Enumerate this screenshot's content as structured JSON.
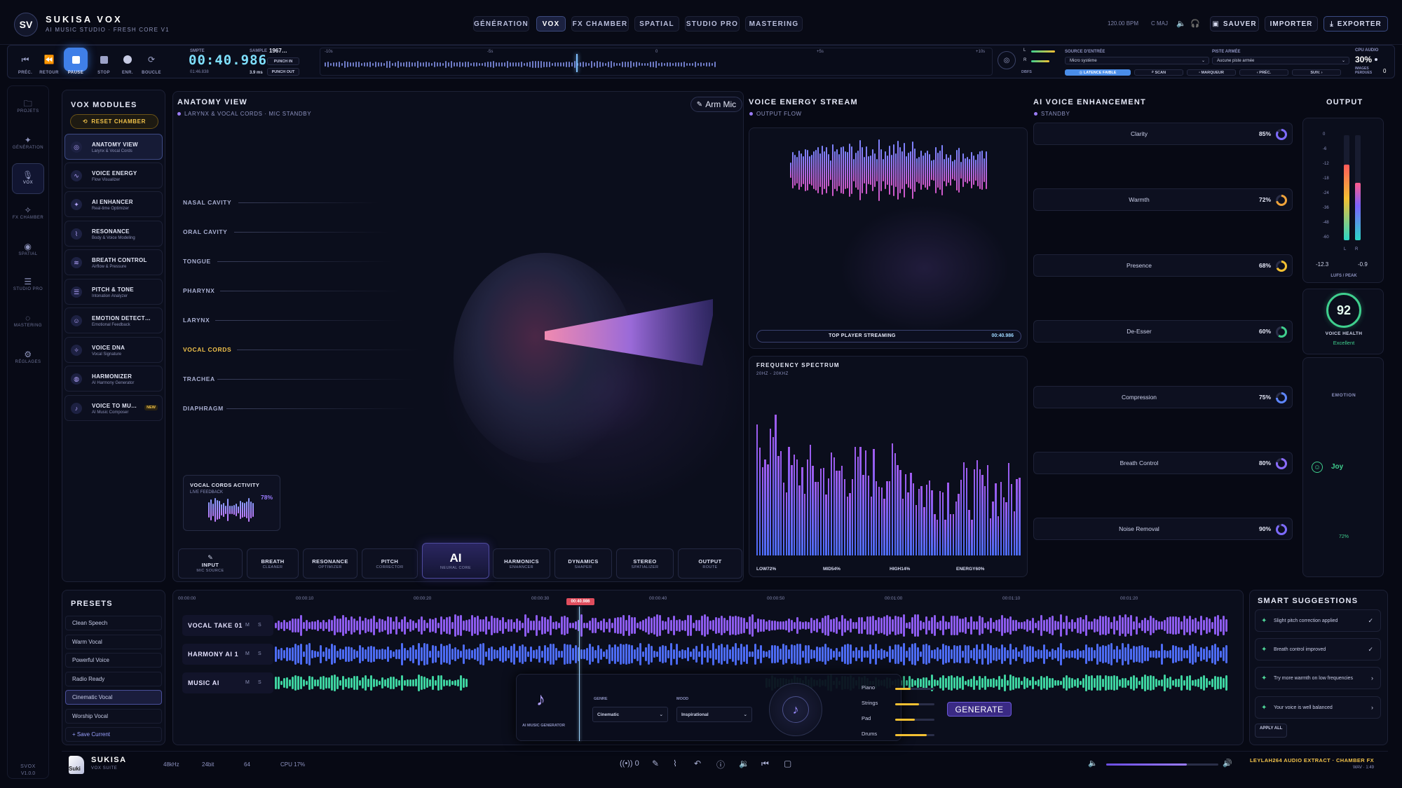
{
  "app": {
    "badge": "SV",
    "name": "SUKISA VOX",
    "tagline": "AI MUSIC STUDIO · FRESH CORE V1"
  },
  "nav_tabs": [
    "GÉNÉRATION",
    "VOX",
    "FX CHAMBER",
    "SPATIAL",
    "STUDIO PRO",
    "MASTERING"
  ],
  "header_right": {
    "bpm": "120.00 BPM",
    "key": "C MAJ",
    "save": "SAUVER",
    "import": "IMPORTER",
    "export": "EXPORTER"
  },
  "transport": {
    "buttons": [
      "PRÉC.",
      "RETOUR",
      "PAUSE",
      "STOP",
      "ENR.",
      "BOUCLE"
    ],
    "smpte_label": "SMPTE",
    "time": "00:40.986",
    "time_small": "01:46.838",
    "sample_label": "SAMPLE",
    "sample_value": "1967…",
    "sample_small": "3.9 ms",
    "punch_in": "PUNCH IN",
    "punch_out": "PUNCH OUT",
    "ruler": [
      "-10s",
      "-5s",
      "0",
      "+5s",
      "+10s"
    ],
    "meter_l": "L",
    "meter_r": "R",
    "dbfs": "DBFS",
    "latency": "LATENCE FAIBLE",
    "input_source_label": "SOURCE D'ENTRÉE",
    "input_source_value": "Micro système",
    "armed_track_label": "PISTE ARMÉE",
    "armed_track_value": "Aucune piste armée",
    "scan": "SCAN",
    "marker": "MARQUEUR",
    "prev": "PRÉC.",
    "next": "SUIV.",
    "cpu_label": "CPU AUDIO",
    "cpu_value": "30%",
    "cpu_meter": 0.3,
    "lost_label": "IMAGES PERDUES",
    "lost_value": "0"
  },
  "left_nav": [
    {
      "label": "PROJETS",
      "icon": "folder-icon"
    },
    {
      "label": "GÉNÉRATION",
      "icon": "sparkle-icon"
    },
    {
      "label": "VOX",
      "icon": "mic-icon"
    },
    {
      "label": "FX CHAMBER",
      "icon": "fx-icon"
    },
    {
      "label": "SPATIAL",
      "icon": "spatial-icon"
    },
    {
      "label": "STUDIO PRO",
      "icon": "sliders-icon"
    },
    {
      "label": "MASTERING",
      "icon": "broadcast-icon"
    },
    {
      "label": "RÉGLAGES",
      "icon": "gear-icon"
    }
  ],
  "version": {
    "name": "SVOX",
    "number": "V1.0.0"
  },
  "modules": {
    "title": "VOX MODULES",
    "reset": "RESET CHAMBER",
    "items": [
      {
        "title": "ANATOMY VIEW",
        "sub": "Larynx & Vocal Cords"
      },
      {
        "title": "VOICE ENERGY",
        "sub": "Flow Visualizer"
      },
      {
        "title": "AI ENHANCER",
        "sub": "Real-time Optimizer"
      },
      {
        "title": "RESONANCE",
        "sub": "Body & Voice Modeling"
      },
      {
        "title": "BREATH CONTROL",
        "sub": "Airflow & Pressure"
      },
      {
        "title": "PITCH & TONE",
        "sub": "Intonation Analyzer"
      },
      {
        "title": "EMOTION DETECT…",
        "sub": "Emotional Feedback"
      },
      {
        "title": "VOICE DNA",
        "sub": "Vocal Signature"
      },
      {
        "title": "HARMONIZER",
        "sub": "AI Harmony Generator"
      },
      {
        "title": "VOICE TO MU…",
        "sub": "AI Music Composer",
        "badge": "NEW"
      }
    ]
  },
  "anatomy": {
    "title": "ANATOMY VIEW",
    "subtitle": "LARYNX & VOCAL CORDS · MIC STANDBY",
    "arm_mic": "Arm Mic",
    "labels": [
      "NASAL CAVITY",
      "ORAL CAVITY",
      "TONGUE",
      "PHARYNX",
      "LARYNX",
      "VOCAL CORDS",
      "TRACHEA",
      "DIAPHRAGM"
    ],
    "activity_title": "VOCAL CORDS ACTIVITY",
    "activity_sub": "LIVE FEEDBACK",
    "activity_value": "78%"
  },
  "stages": [
    {
      "title": "INPUT",
      "sub": "MIC SOURCE"
    },
    {
      "title": "BREATH",
      "sub": "CLEANER"
    },
    {
      "title": "RESONANCE",
      "sub": "OPTIMIZER"
    },
    {
      "title": "PITCH",
      "sub": "CORRECTOR"
    },
    {
      "title": "AI",
      "sub": "NEURAL CORE"
    },
    {
      "title": "HARMONICS",
      "sub": "ENHANCER"
    },
    {
      "title": "DYNAMICS",
      "sub": "SHAPER"
    },
    {
      "title": "STEREO",
      "sub": "SPATIALIZER"
    },
    {
      "title": "OUTPUT",
      "sub": "ROUTE"
    }
  ],
  "energy": {
    "title": "VOICE ENERGY STREAM",
    "subtitle": "OUTPUT FLOW",
    "streaming": "TOP PLAYER STREAMING",
    "time": "00:40.986"
  },
  "spectrum": {
    "title": "FREQUENCY SPECTRUM",
    "range": "20HZ - 20KHZ",
    "stats": [
      "LOW72%",
      "MID54%",
      "HIGH14%",
      "ENERGY60%"
    ]
  },
  "enhancement": {
    "title": "AI VOICE ENHANCEMENT",
    "status": "STANDBY",
    "rows": [
      {
        "label": "Clarity",
        "value": "85%",
        "pct": 85,
        "color": "#7d6bff"
      },
      {
        "label": "Warmth",
        "value": "72%",
        "pct": 72,
        "color": "#f0a33a"
      },
      {
        "label": "Presence",
        "value": "68%",
        "pct": 68,
        "color": "#f3c032"
      },
      {
        "label": "De-Esser",
        "value": "60%",
        "pct": 60,
        "color": "#3fcf8e"
      },
      {
        "label": "Compression",
        "value": "75%",
        "pct": 75,
        "color": "#5e86ff"
      },
      {
        "label": "Breath Control",
        "value": "80%",
        "pct": 80,
        "color": "#8a6cff"
      },
      {
        "label": "Noise Removal",
        "value": "90%",
        "pct": 90,
        "color": "#7d6bff"
      }
    ]
  },
  "output": {
    "title": "OUTPUT",
    "scale": [
      "0",
      "-6",
      "-12",
      "-18",
      "-24",
      "-36",
      "-48",
      "-60"
    ],
    "ch_l": "L",
    "ch_r": "R",
    "lufs": "-12.3",
    "peak": "-0.9",
    "lufs_label": "LUFS / PEAK",
    "level_l": 0.72,
    "level_r": 0.55,
    "health_value": "92",
    "health_label": "VOICE HEALTH",
    "health_status": "Excellent",
    "emotion_title": "EMOTION",
    "emotion_value": "Joy",
    "emotion_pct": "72%"
  },
  "presets": {
    "title": "PRESETS",
    "items": [
      "Clean Speech",
      "Warm Vocal",
      "Powerful Voice",
      "Radio Ready",
      "Cinematic Vocal",
      "Worship Vocal"
    ],
    "save": "+ Save Current"
  },
  "timeline": {
    "ticks": [
      "00:00:00",
      "00:00:10",
      "00:00:20",
      "00:00:30",
      "00:00:40",
      "00:00:50",
      "00:01:00",
      "00:01:10",
      "00:01:20"
    ],
    "playhead": "00:40.986",
    "tracks": [
      {
        "name": "VOCAL TAKE 01",
        "m": "M",
        "s": "S",
        "color": "#8d5cf0"
      },
      {
        "name": "HARMONY AI 1",
        "m": "M",
        "s": "S",
        "color": "#4d6cf7"
      },
      {
        "name": "MUSIC AI",
        "m": "M",
        "s": "S",
        "color": "#3ed3a0"
      }
    ]
  },
  "generator": {
    "label": "AI MUSIC GENERATOR",
    "genre_label": "GENRE",
    "genre": "Cinematic",
    "mood_label": "MOOD",
    "mood": "Inspirational",
    "instruments": [
      {
        "name": "Piano",
        "level": 0.4
      },
      {
        "name": "Strings",
        "level": 0.6
      },
      {
        "name": "Pad",
        "level": 0.5
      },
      {
        "name": "Drums",
        "level": 0.8
      }
    ],
    "generate": "GENERATE"
  },
  "suggestions": {
    "title": "SMART SUGGESTIONS",
    "items": [
      {
        "text": "Slight pitch correction applied",
        "action": "✓"
      },
      {
        "text": "Breath control improved",
        "action": "✓"
      },
      {
        "text": "Try more warmth on low frequencies",
        "action": "›"
      },
      {
        "text": "Your voice is well balanced",
        "action": "›"
      }
    ],
    "apply": "APPLY ALL"
  },
  "footer": {
    "name": "SUKISA",
    "sub": "VOX SUITE",
    "logo_text": "Suki",
    "rate": "48kHz",
    "bits": "24bit",
    "buffer": "64",
    "cpu": "CPU 17%",
    "monitor": "0",
    "volume": 0.72,
    "track": "LEYLAH264 AUDIO EXTRACT · CHAMBER FX",
    "format": "WAV · 1:49"
  }
}
